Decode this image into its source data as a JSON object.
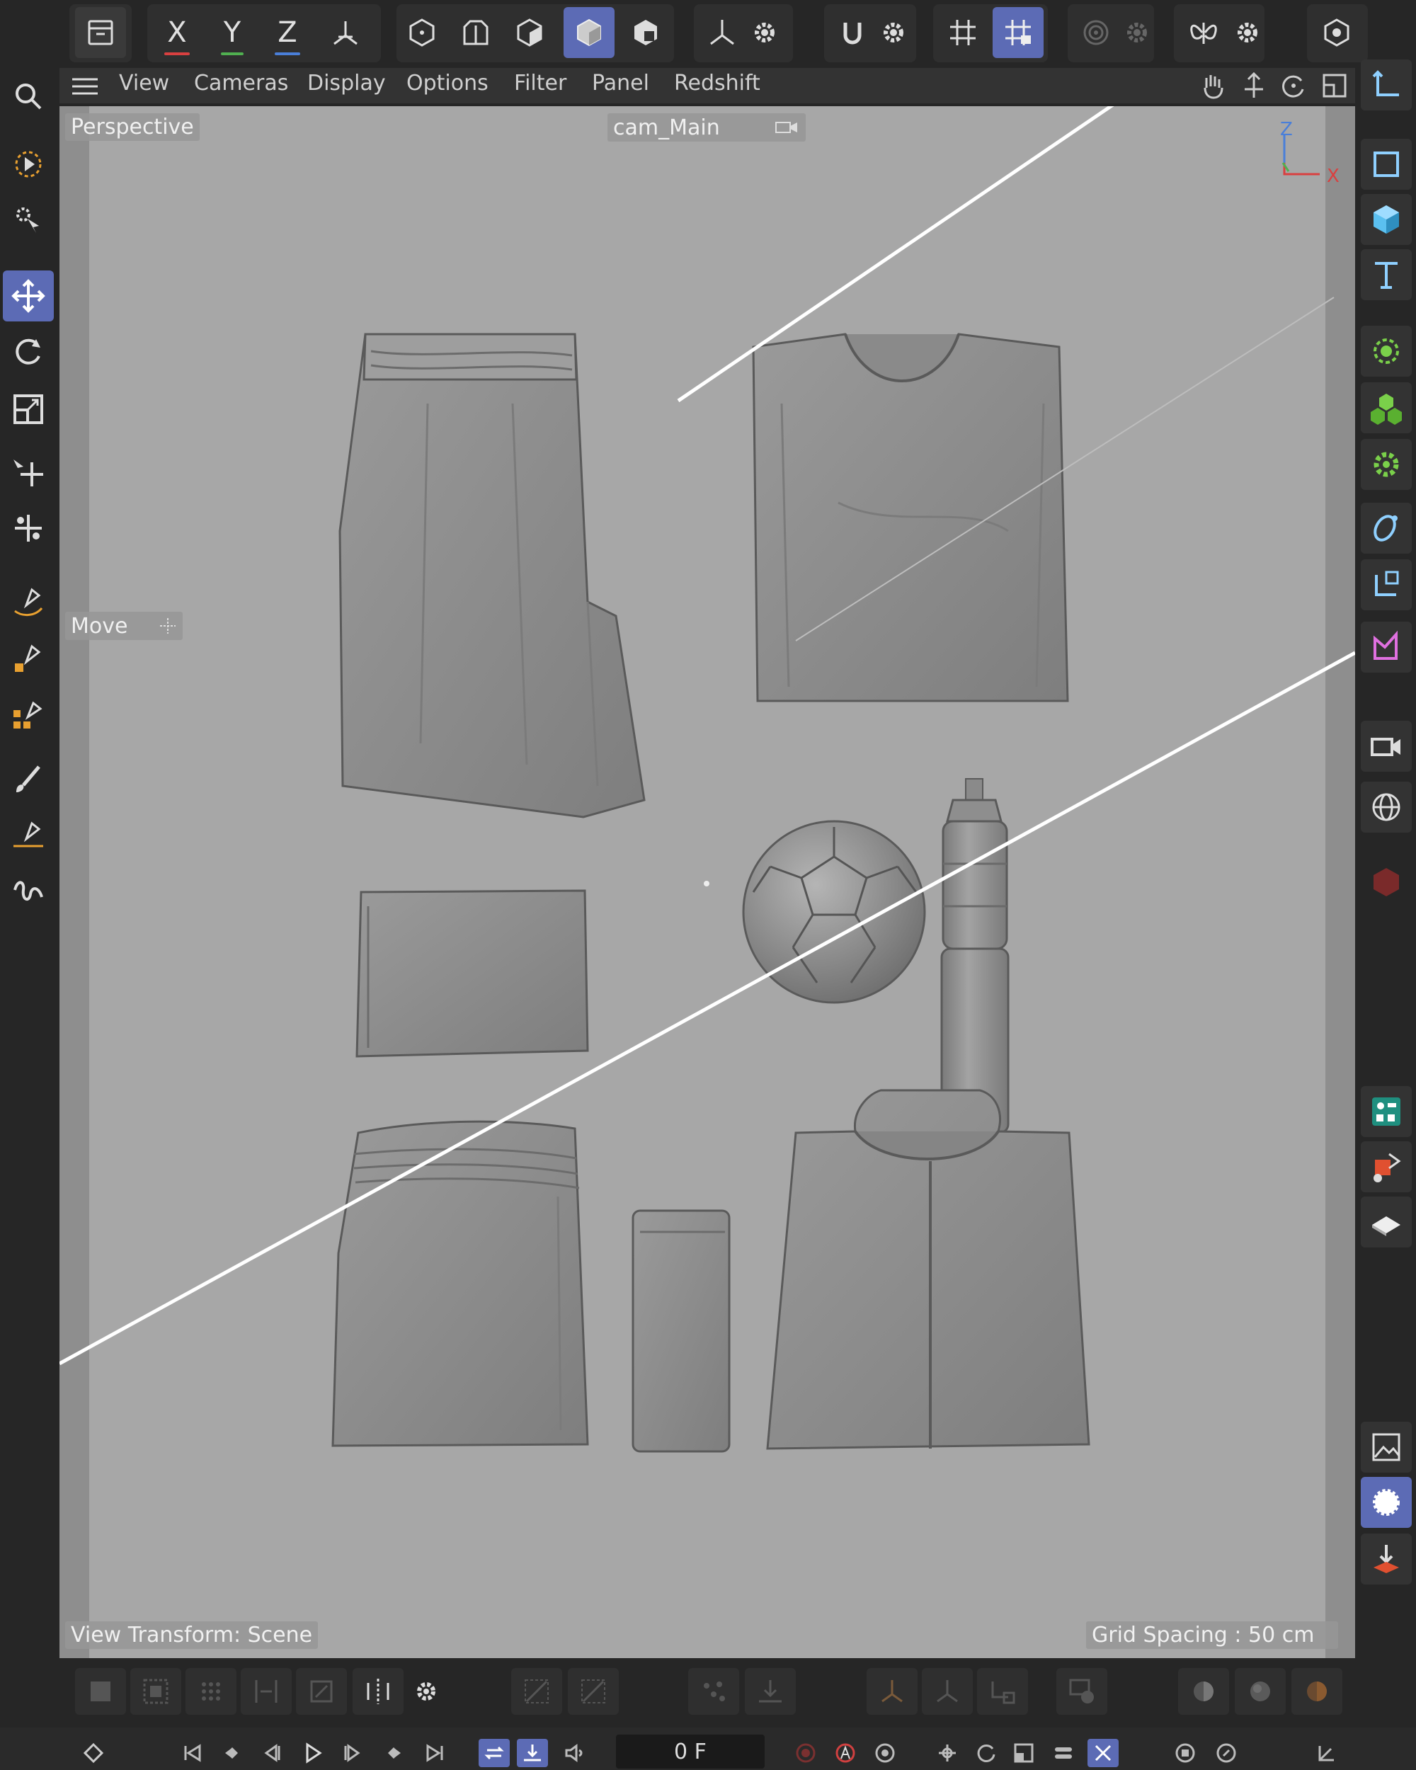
{
  "toolbar": {
    "axis_x": "X",
    "axis_y": "Y",
    "axis_z": "Z"
  },
  "menu": {
    "items": [
      "View",
      "Cameras",
      "Display",
      "Options",
      "Filter",
      "Panel",
      "Redshift"
    ]
  },
  "viewport": {
    "view_name": "Perspective",
    "camera": "cam_Main",
    "tool_label": "Move",
    "view_transform": "View Transform: Scene",
    "grid_spacing": "Grid Spacing : 50 cm",
    "axis_gizmo_z": "Z",
    "axis_gizmo_x": "X"
  },
  "timeline": {
    "frame": "0 F"
  },
  "colors": {
    "accent": "#5c6bb5",
    "viewport_bg": "#a7a7a7",
    "panel_bg": "#262626",
    "axis_x": "#d94040",
    "axis_y": "#50b050",
    "axis_z": "#4a7fd9"
  }
}
